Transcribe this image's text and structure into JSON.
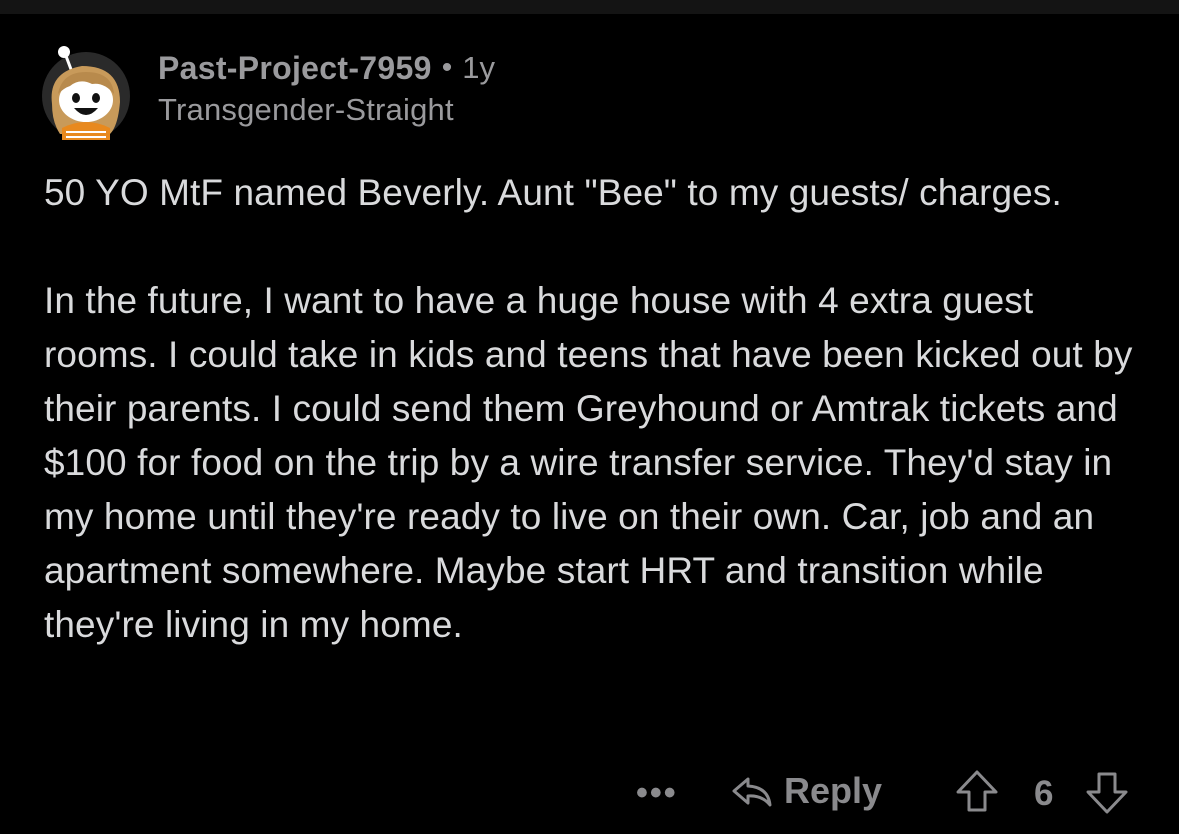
{
  "comment": {
    "username": "Past-Project-7959",
    "separator": "•",
    "age": "1y",
    "flair": "Transgender-Straight",
    "avatar": "snoo-avatar-icon",
    "paragraphs": [
      "50 YO MtF named Beverly. Aunt \"Bee\" to my guests/ charges.",
      "In the future, I want to have a huge house with 4 extra guest rooms. I could take in kids and teens that have been kicked out by their parents. I could send them Greyhound or Amtrak tickets and $100 for food on the trip by a wire transfer service. They'd stay in my home until they're ready to live on their own. Car, job and an apartment somewhere. Maybe start HRT and transition while they're living in my home."
    ]
  },
  "actions": {
    "more_label": "•••",
    "reply_label": "Reply",
    "score": "6",
    "icons": [
      "more-icon",
      "reply-arrow-icon",
      "upvote-icon",
      "downvote-icon"
    ]
  },
  "colors": {
    "background": "#000000",
    "text": "#d9dadc",
    "meta": "#9a9a9d",
    "action": "#8a8a8d",
    "avatar_hair": "#c89a5a",
    "avatar_shirt": "#e8891e"
  }
}
